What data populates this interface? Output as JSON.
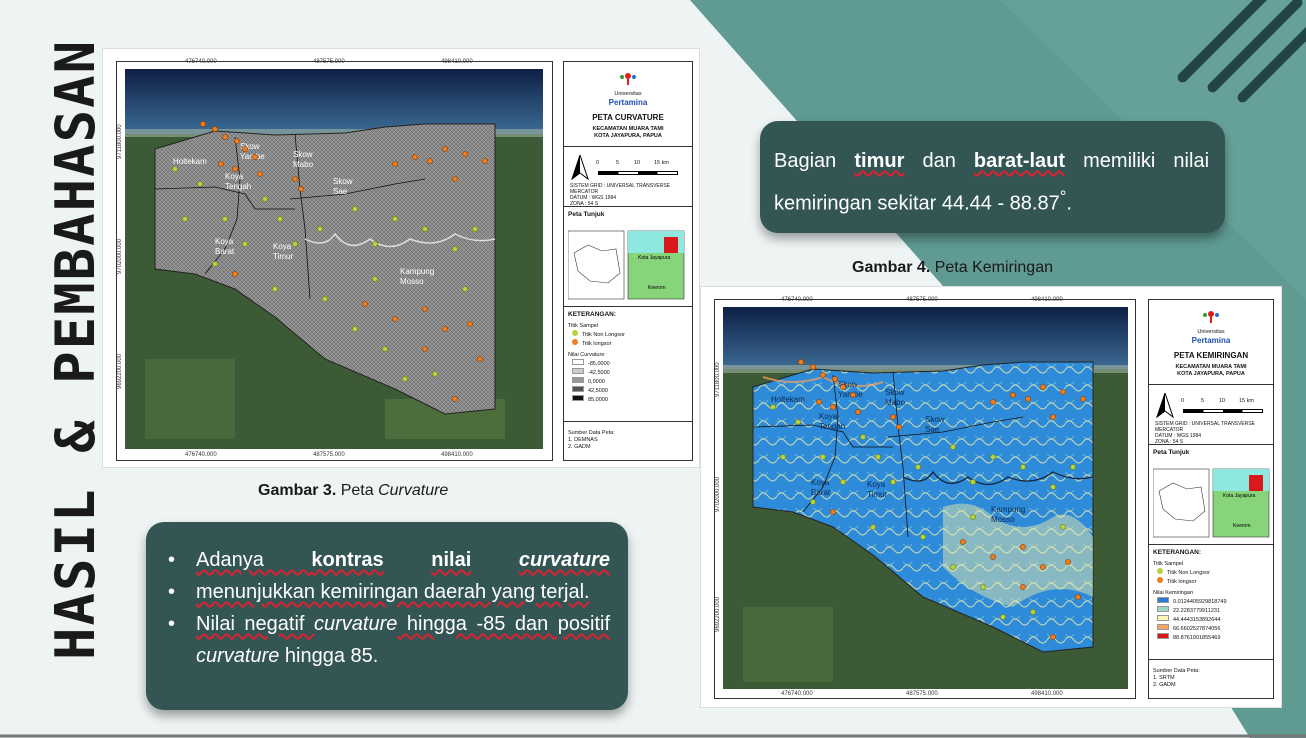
{
  "slide_title": "HASIL & PEMBAHASAN",
  "map1": {
    "title": "PETA CURVATURE",
    "university_small": "Universitas",
    "university": "Pertamina",
    "location_line1": "KECAMATAN MUARA TAMI",
    "location_line2": "KOTA JAYAPURA, PAPUA",
    "scale_labels": [
      "0",
      "5",
      "10",
      "15 km"
    ],
    "grid_line1": "SISTEM GRID : UNIVERSAL TRANSVERSE MERCATOR",
    "grid_line2": "DATUM        : WGS 1984",
    "grid_line3": "ZONA          : 54 S",
    "peta_tunjuk": "Peta Tunjuk",
    "keterangan": "KETERANGAN:",
    "titik_sampel": "Titik Sampel",
    "non_longsor": "Titik Non Longsor",
    "longsor": "Titik longsor",
    "nilai_label": "Nilai Curvature",
    "nilai_values": [
      "-85,0000",
      "-42,5000",
      "0,0000",
      "42,5000",
      "85,0000"
    ],
    "nilai_colors": [
      "#ffffff",
      "#cccccc",
      "#999999",
      "#555555",
      "#111111"
    ],
    "sumber_title": "Sumber Data Peta:",
    "sumber_1": "1. DEMNAS",
    "sumber_2": "2. GADM",
    "x_coords": [
      "476740.000",
      "487575.000",
      "498410.000"
    ],
    "y_coords": [
      "9711800.000",
      "9702000.000",
      "9692200.000"
    ],
    "regions": [
      "Holtekam",
      "Skow Yambe",
      "Skow Mabo",
      "Koya Tengah",
      "Skow Sae",
      "Koya Barat",
      "Koya Timur",
      "Kampung Mosso"
    ],
    "inset_labels": [
      "Kota Jayapura",
      "Keerom"
    ]
  },
  "map2": {
    "title": "PETA KEMIRINGAN",
    "university_small": "Universitas",
    "university": "Pertamina",
    "location_line1": "KECAMATAN MUARA TAMI",
    "location_line2": "KOTA JAYAPURA, PAPUA",
    "scale_labels": [
      "0",
      "5",
      "10",
      "15 km"
    ],
    "grid_line1": "SISTEM GRID : UNIVERSAL TRANSVERSE MERCATOR",
    "grid_line2": "DATUM        : WGS 1984",
    "grid_line3": "ZONA          : 54 S",
    "peta_tunjuk": "Peta Tunjuk",
    "keterangan": "KETERANGAN:",
    "titik_sampel": "Titik Sampel",
    "non_longsor": "Titik Non Longsor",
    "longsor": "Titik longsor",
    "nilai_label": "Nilai Kemiringan",
    "nilai_values": [
      "0.0124405929818749",
      "22.2283779911231",
      "44.4443153892644",
      "66.6602527874056",
      "88.8761901855469"
    ],
    "nilai_colors": [
      "#2b7bd6",
      "#9fd6c8",
      "#fbf7b5",
      "#f5a35f",
      "#d7191c"
    ],
    "sumber_title": "Sumber Data Peta:",
    "sumber_1": "1. SRTM",
    "sumber_2": "2. GADM",
    "x_coords": [
      "476740.000",
      "487575.000",
      "498410.000"
    ],
    "y_coords": [
      "9711800.000",
      "9702000.000",
      "9692200.000"
    ],
    "regions": [
      "Holtekam",
      "Skow Yambe",
      "Skow Mabo",
      "Koya Tengah",
      "Skow Sae",
      "Koya Barat",
      "Koya Timur",
      "Kampung Mosso"
    ],
    "inset_labels": [
      "Kota Jayapura",
      "Keerom"
    ]
  },
  "caption3": {
    "bold": "Gambar 3.",
    "text": " Peta ",
    "italic": "Curvature"
  },
  "caption4": {
    "bold": "Gambar 4.",
    "text": " Peta Kemiringan"
  },
  "box_top": {
    "p1": "Bagian ",
    "b1": "timur",
    "p2": " dan ",
    "b2": "barat-laut",
    "p3": " memiliki nilai kemiringan sekitar 44.44 - 88.87",
    "deg": "°",
    "p4": "."
  },
  "box_bottom": {
    "b1_a": "Adanya ",
    "b1_bold1": "kontras",
    "b1_bold2": "nilai",
    "b1_italic": "curvature",
    "b1_b": "menunjukkan kemiringan daerah yang terjal.",
    "b2_a": "Nilai negatif ",
    "b2_italic": "curvature",
    "b2_b": " hingga -85 dan positif ",
    "b2_italic2": "curvature",
    "b2_c": " hingga 85."
  },
  "colors": {
    "teal_dark": "#335553",
    "teal_bg": "#5f9a93",
    "non_longsor": "#b5d33a",
    "longsor": "#f27d1c"
  }
}
